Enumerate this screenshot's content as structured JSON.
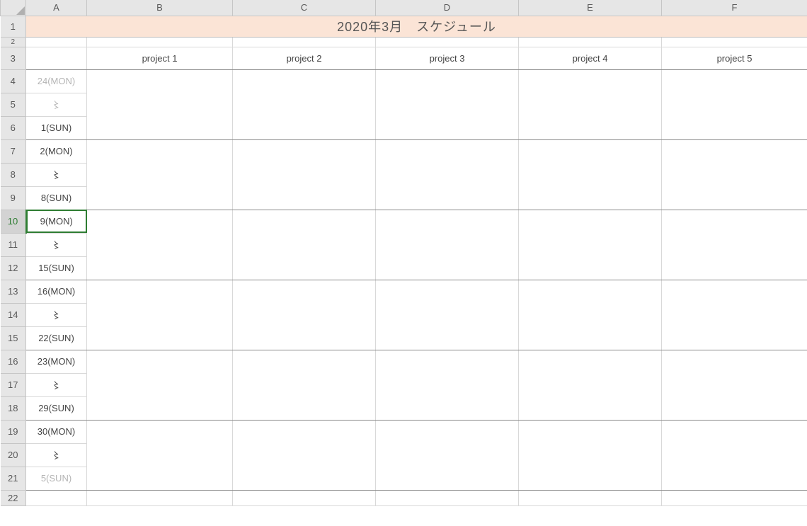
{
  "columns": {
    "A": "A",
    "B": "B",
    "C": "C",
    "D": "D",
    "E": "E",
    "F": "F"
  },
  "rows": {
    "r1": "1",
    "r2": "2",
    "r3": "3",
    "r4": "4",
    "r5": "5",
    "r6": "6",
    "r7": "7",
    "r8": "8",
    "r9": "9",
    "r10": "10",
    "r11": "11",
    "r12": "12",
    "r13": "13",
    "r14": "14",
    "r15": "15",
    "r16": "16",
    "r17": "17",
    "r18": "18",
    "r19": "19",
    "r20": "20",
    "r21": "21",
    "r22": "22"
  },
  "title": "2020年3月　スケジュール",
  "projects": {
    "p1": "project 1",
    "p2": "project 2",
    "p3": "project 3",
    "p4": "project 4",
    "p5": "project 5"
  },
  "dates": {
    "d4": "24(MON)",
    "d5": "〻",
    "d6": "1(SUN)",
    "d7": "2(MON)",
    "d8": "〻",
    "d9": "8(SUN)",
    "d10": "9(MON)",
    "d11": "〻",
    "d12": "15(SUN)",
    "d13": "16(MON)",
    "d14": "〻",
    "d15": "22(SUN)",
    "d16": "23(MON)",
    "d17": "〻",
    "d18": "29(SUN)",
    "d19": "30(MON)",
    "d20": "〻",
    "d21": "5(SUN)"
  },
  "active_cell": "A10"
}
